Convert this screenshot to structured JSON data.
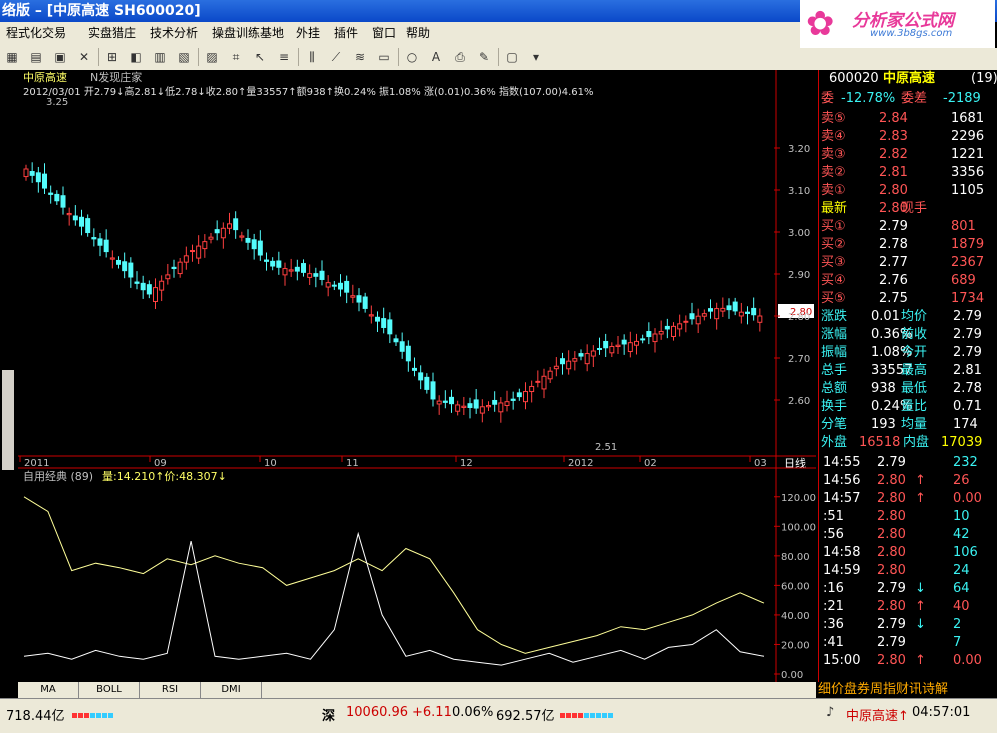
{
  "window": {
    "title": "络版 – [中原高速 SH600020]"
  },
  "logo": {
    "brand": "分析家公式网",
    "url": "www.3b8gs.com"
  },
  "menu": [
    "程式化交易",
    "实盘猎庄",
    "技术分析",
    "操盘训练基地",
    "外挂",
    "插件",
    "窗口",
    "帮助"
  ],
  "chart": {
    "stock_name": "中原高速",
    "indicator_name": "N发现庄家",
    "info_line": "2012/03/01 开2.79↓高2.81↓低2.78↓收2.80↑量33557↑额938↑换0.24% 振1.08% 涨(0.01)0.36% 指数(107.00)4.61%",
    "high_marker": "3.25",
    "low_marker": "2.51",
    "price_badge": "2.80",
    "price_ticks": [
      "3.20",
      "3.10",
      "3.00",
      "2.90",
      "2.80",
      "2.70",
      "2.60"
    ],
    "date_labels": [
      "2011",
      "09",
      "10",
      "11",
      "12",
      "2012",
      "02",
      "03"
    ],
    "period_label": "日线",
    "sub_title": "自用经典 (89)",
    "sub_values": "量:14.210↑价:48.307↓",
    "sub_ticks": [
      "120.00",
      "100.00",
      "80.00",
      "60.00",
      "40.00",
      "20.00",
      "0.00"
    ]
  },
  "chart_data": [
    {
      "type": "candlestick",
      "title": "中原高速",
      "ylim": [
        2.5,
        3.3
      ],
      "x": [
        "2011-07",
        "2011-09",
        "2011-10",
        "2011-11",
        "2011-12",
        "2012-01",
        "2012-02",
        "2012-03"
      ],
      "close": [
        3.15,
        3.05,
        2.95,
        2.85,
        2.95,
        3.02,
        2.92,
        2.9,
        2.85,
        2.75,
        2.6,
        2.58,
        2.6,
        2.68,
        2.72,
        2.74,
        2.78,
        2.82,
        2.8
      ],
      "annotations": {
        "high": 3.25,
        "low": 2.51,
        "last": 2.8
      }
    },
    {
      "type": "line",
      "title": "自用经典 (89)",
      "ylim": [
        0,
        130
      ],
      "series": [
        {
          "name": "量",
          "values": [
            120,
            110,
            70,
            75,
            72,
            68,
            78,
            74,
            80,
            75,
            72,
            60,
            65,
            70,
            78,
            70,
            85,
            78,
            55,
            30,
            20,
            14,
            18,
            22,
            26,
            32,
            30,
            35,
            40,
            48,
            55,
            48
          ]
        },
        {
          "name": "价",
          "values": [
            12,
            14,
            10,
            16,
            12,
            10,
            14,
            90,
            12,
            10,
            12,
            14,
            10,
            30,
            95,
            40,
            12,
            16,
            10,
            8,
            6,
            10,
            14,
            8,
            12,
            16,
            10,
            18,
            20,
            30,
            15,
            12
          ]
        }
      ]
    }
  ],
  "quote": {
    "code": "600020",
    "name": "中原高速",
    "badge": "(19)",
    "wei_bi_label": "委",
    "wei_bi": "-12.78%",
    "wei_cha_label": "委差",
    "wei_cha": "-2189",
    "sells": [
      {
        "l": "卖⑤",
        "p": "2.84",
        "v": "1681"
      },
      {
        "l": "卖④",
        "p": "2.83",
        "v": "2296"
      },
      {
        "l": "卖③",
        "p": "2.82",
        "v": "1221"
      },
      {
        "l": "卖②",
        "p": "2.81",
        "v": "3356"
      },
      {
        "l": "卖①",
        "p": "2.80",
        "v": "1105"
      }
    ],
    "last_label": "最新",
    "last": "2.80",
    "now_label": "现手",
    "buys": [
      {
        "l": "买①",
        "p": "2.79",
        "v": "801"
      },
      {
        "l": "买②",
        "p": "2.78",
        "v": "1879"
      },
      {
        "l": "买③",
        "p": "2.77",
        "v": "2367"
      },
      {
        "l": "买④",
        "p": "2.76",
        "v": "689"
      },
      {
        "l": "买⑤",
        "p": "2.75",
        "v": "1734"
      }
    ],
    "stats": [
      {
        "a": "涨跌",
        "b": "0.01",
        "c": "均价",
        "d": "2.79"
      },
      {
        "a": "涨幅",
        "b": "0.36%",
        "c": "前收",
        "d": "2.79"
      },
      {
        "a": "振幅",
        "b": "1.08%",
        "c": "今开",
        "d": "2.79"
      },
      {
        "a": "总手",
        "b": "33557",
        "c": "最高",
        "d": "2.81"
      },
      {
        "a": "总额",
        "b": "938",
        "c": "最低",
        "d": "2.78"
      },
      {
        "a": "换手",
        "b": "0.24%",
        "c": "量比",
        "d": "0.71"
      },
      {
        "a": "分笔",
        "b": "193",
        "c": "均量",
        "d": "174"
      }
    ],
    "outer_label": "外盘",
    "outer": "16518",
    "inner_label": "内盘",
    "inner": "17039",
    "ticks": [
      {
        "t": "14:55",
        "p": "2.79",
        "a": "",
        "v": "232"
      },
      {
        "t": "14:56",
        "p": "2.80",
        "a": "↑",
        "v": "26"
      },
      {
        "t": "14:57",
        "p": "2.80",
        "a": "↑",
        "v": "0.00"
      },
      {
        "t": ":51",
        "p": "2.80",
        "a": "",
        "v": "10"
      },
      {
        "t": ":56",
        "p": "2.80",
        "a": "",
        "v": "42"
      },
      {
        "t": "14:58",
        "p": "2.80",
        "a": "",
        "v": "106"
      },
      {
        "t": "14:59",
        "p": "2.80",
        "a": "",
        "v": "24"
      },
      {
        "t": ":16",
        "p": "2.79",
        "a": "↓",
        "v": "64"
      },
      {
        "t": ":21",
        "p": "2.80",
        "a": "↑",
        "v": "40"
      },
      {
        "t": ":36",
        "p": "2.79",
        "a": "↓",
        "v": "2"
      },
      {
        "t": ":41",
        "p": "2.79",
        "a": "",
        "v": "7"
      },
      {
        "t": "15:00",
        "p": "2.80",
        "a": "↑",
        "v": "0.00"
      }
    ]
  },
  "tabs": [
    "MA",
    "BOLL",
    "RSI",
    "DMI"
  ],
  "marquee": "细价盘券周指财讯诗解",
  "status": {
    "left_amount": "718.44亿",
    "shen_label": "深",
    "shen_index": "10060.96",
    "shen_change": "+6.11",
    "shen_pct": "0.06%",
    "shen_amount": "692.57亿",
    "ticker": "中原高速↑",
    "time": "04:57:01"
  }
}
